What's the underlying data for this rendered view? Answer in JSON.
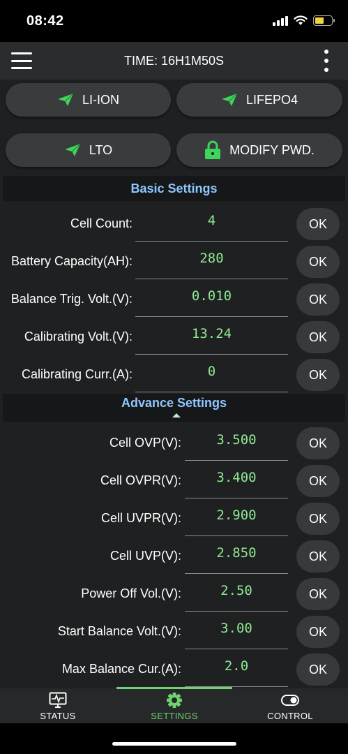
{
  "status_bar": {
    "time": "08:42"
  },
  "header": {
    "title": "TIME: 16H1M50S"
  },
  "presets": [
    {
      "label": "LI-ION",
      "icon": "plane-icon"
    },
    {
      "label": "LIFEPO4",
      "icon": "plane-icon"
    },
    {
      "label": "LTO",
      "icon": "plane-icon"
    },
    {
      "label": "MODIFY PWD.",
      "icon": "lock-icon"
    }
  ],
  "basic": {
    "title": "Basic Settings",
    "rows": [
      {
        "label": "Cell Count:",
        "value": "4",
        "ok": "OK"
      },
      {
        "label": "Battery Capacity(AH):",
        "value": "280",
        "ok": "OK"
      },
      {
        "label": "Balance Trig. Volt.(V):",
        "value": "0.010",
        "ok": "OK"
      },
      {
        "label": "Calibrating Volt.(V):",
        "value": "13.24",
        "ok": "OK"
      },
      {
        "label": "Calibrating Curr.(A):",
        "value": "0",
        "ok": "OK"
      }
    ]
  },
  "advance": {
    "title": "Advance Settings",
    "rows": [
      {
        "label": "Cell OVP(V):",
        "value": "3.500",
        "ok": "OK"
      },
      {
        "label": "Cell OVPR(V):",
        "value": "3.400",
        "ok": "OK"
      },
      {
        "label": "Cell UVPR(V):",
        "value": "2.900",
        "ok": "OK"
      },
      {
        "label": "Cell UVP(V):",
        "value": "2.850",
        "ok": "OK"
      },
      {
        "label": "Power Off Vol.(V):",
        "value": "2.50",
        "ok": "OK"
      },
      {
        "label": "Start Balance Volt.(V):",
        "value": "3.00",
        "ok": "OK"
      },
      {
        "label": "Max Balance Cur.(A):",
        "value": "2.0",
        "ok": "OK"
      }
    ]
  },
  "nav": [
    {
      "label": "STATUS",
      "icon": "monitor-icon",
      "active": false
    },
    {
      "label": "SETTINGS",
      "icon": "gear-icon",
      "active": true
    },
    {
      "label": "CONTROL",
      "icon": "toggle-icon",
      "active": false
    }
  ],
  "colors": {
    "accent_green": "#6fd36f",
    "value_green": "#8eea93",
    "section_title_blue": "#8ec6ff",
    "battery_yellow": "#f2d53c"
  }
}
